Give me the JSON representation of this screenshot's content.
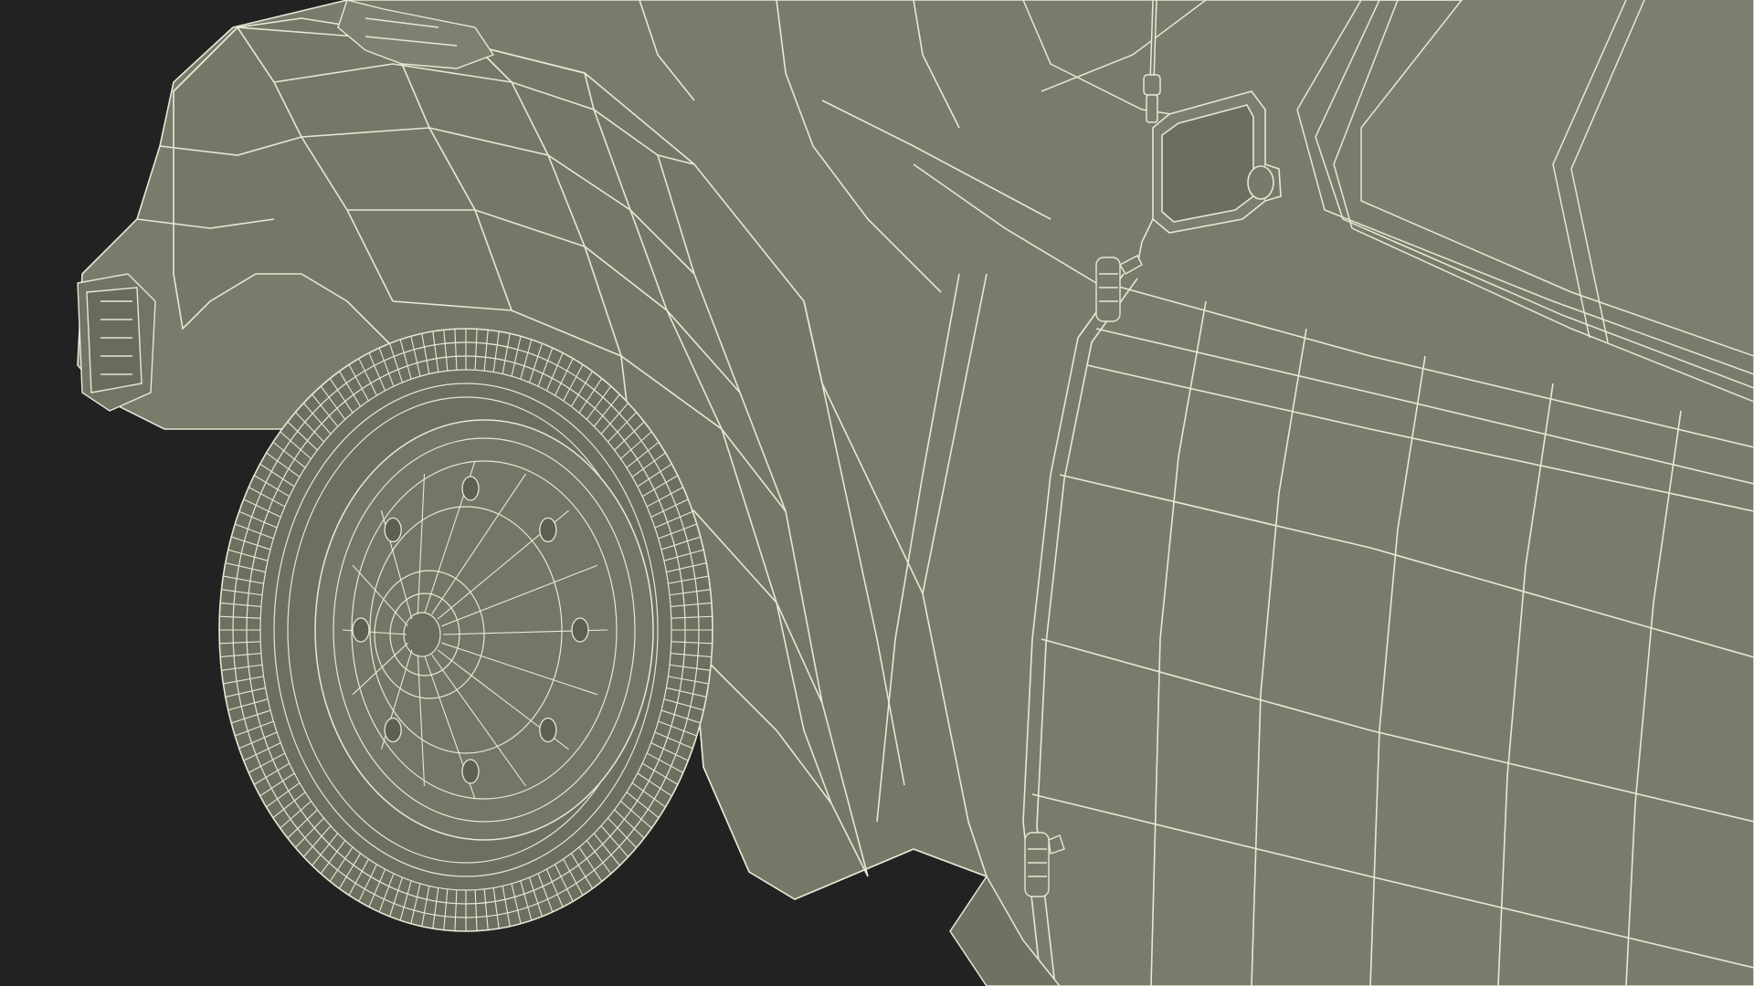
{
  "scene": {
    "background_color": "#222222",
    "surface_color": "#7b7b6b",
    "surface_shadow_color": "#6a6a5c",
    "wire_color": "#e8e8d6"
  },
  "objects": [
    {
      "name": "front-fender",
      "label": ""
    },
    {
      "name": "wheel-tire",
      "label": ""
    },
    {
      "name": "wheel-hub",
      "label": ""
    },
    {
      "name": "side-mirror",
      "label": ""
    },
    {
      "name": "door-hinge-upper",
      "label": ""
    },
    {
      "name": "door-hinge-lower",
      "label": ""
    },
    {
      "name": "antenna",
      "label": ""
    },
    {
      "name": "headlight-housing",
      "label": ""
    },
    {
      "name": "windshield-frame",
      "label": ""
    }
  ]
}
